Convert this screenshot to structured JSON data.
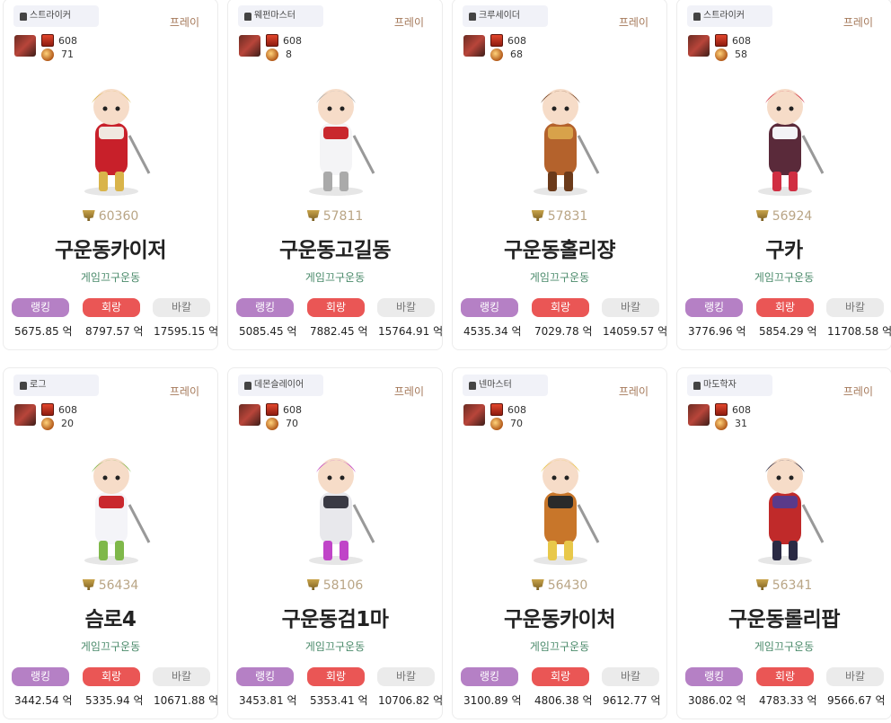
{
  "cards": [
    {
      "job": "스트라이커",
      "play": "프레이",
      "fame": "608",
      "level": "71",
      "score": "60360",
      "name": "구운동카이저",
      "guild": "게임끄구운동",
      "btn_rank": "랭킹",
      "btn_hoe": "회랑",
      "btn_bar": "바칼",
      "val_rank": "5675.85 억",
      "val_hoe": "8797.57 억",
      "val_bar": "17595.15 억"
    },
    {
      "job": "웨펀마스터",
      "play": "프레이",
      "fame": "608",
      "level": "8",
      "score": "57811",
      "name": "구운동고길동",
      "guild": "게임끄구운동",
      "btn_rank": "랭킹",
      "btn_hoe": "회랑",
      "btn_bar": "바칼",
      "val_rank": "5085.45 억",
      "val_hoe": "7882.45 억",
      "val_bar": "15764.91 억"
    },
    {
      "job": "크루세이더",
      "play": "프레이",
      "fame": "608",
      "level": "68",
      "score": "57831",
      "name": "구운동홀리쟝",
      "guild": "게임끄구운동",
      "btn_rank": "랭킹",
      "btn_hoe": "회랑",
      "btn_bar": "바칼",
      "val_rank": "4535.34 억",
      "val_hoe": "7029.78 억",
      "val_bar": "14059.57 억"
    },
    {
      "job": "스트라이커",
      "play": "프레이",
      "fame": "608",
      "level": "58",
      "score": "56924",
      "name": "구카",
      "guild": "게임끄구운동",
      "btn_rank": "랭킹",
      "btn_hoe": "회랑",
      "btn_bar": "바칼",
      "val_rank": "3776.96 억",
      "val_hoe": "5854.29 억",
      "val_bar": "11708.58 억"
    },
    {
      "job": "로그",
      "play": "프레이",
      "fame": "608",
      "level": "20",
      "score": "56434",
      "name": "슴로4",
      "guild": "게임끄구운동",
      "btn_rank": "랭킹",
      "btn_hoe": "회랑",
      "btn_bar": "바칼",
      "val_rank": "3442.54 억",
      "val_hoe": "5335.94 억",
      "val_bar": "10671.88 억"
    },
    {
      "job": "데몬슬레이어",
      "play": "프레이",
      "fame": "608",
      "level": "70",
      "score": "58106",
      "name": "구운동검1마",
      "guild": "게임끄구운동",
      "btn_rank": "랭킹",
      "btn_hoe": "회랑",
      "btn_bar": "바칼",
      "val_rank": "3453.81 억",
      "val_hoe": "5353.41 억",
      "val_bar": "10706.82 억"
    },
    {
      "job": "넨마스터",
      "play": "프레이",
      "fame": "608",
      "level": "70",
      "score": "56430",
      "name": "구운동카이처",
      "guild": "게임끄구운동",
      "btn_rank": "랭킹",
      "btn_hoe": "회랑",
      "btn_bar": "바칼",
      "val_rank": "3100.89 억",
      "val_hoe": "4806.38 억",
      "val_bar": "9612.77 억"
    },
    {
      "job": "마도학자",
      "play": "프레이",
      "fame": "608",
      "level": "31",
      "score": "56341",
      "name": "구운동롤리팝",
      "guild": "게임끄구운동",
      "btn_rank": "랭킹",
      "btn_hoe": "회랑",
      "btn_bar": "바칼",
      "val_rank": "3086.02 억",
      "val_hoe": "4783.33 억",
      "val_bar": "9566.67 억"
    }
  ],
  "colors": {
    "rank": "#b580c5",
    "hoe": "#ea5655",
    "bar": "#ebebeb",
    "play": "#a5795a",
    "guild": "#4a8a6a",
    "score": "#b9a585"
  },
  "icons": {
    "job": "helmet-icon",
    "fame": "fame-icon",
    "level": "level-icon",
    "score": "trophy-icon"
  }
}
